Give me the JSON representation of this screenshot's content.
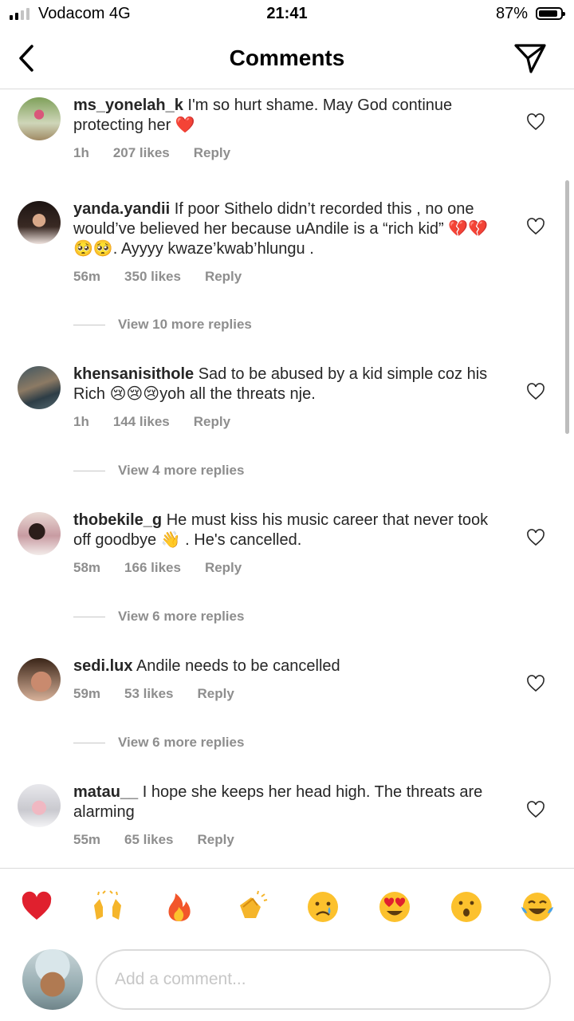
{
  "status_bar": {
    "carrier": "Vodacom  4G",
    "time": "21:41",
    "battery": "87%"
  },
  "header": {
    "title": "Comments"
  },
  "comments": [
    {
      "username": "ms_yonelah_k",
      "text": " I'm so hurt shame. May God continue protecting her ❤️",
      "age": "1h",
      "likes": "207 likes",
      "reply": "Reply"
    },
    {
      "username": "yanda.yandii",
      "text": " If poor Sithelo didn’t recorded this , no one would’ve believed her because uAndile is a “rich kid” 💔💔🥺🥺. Ayyyy kwaze’kwab’hlungu .",
      "age": "56m",
      "likes": "350 likes",
      "reply": "Reply",
      "view_replies": "View 10 more replies"
    },
    {
      "username": "khensanisithole",
      "text": " Sad to be abused by a kid simple coz his Rich 😢😢😢yoh all the threats nje.",
      "age": "1h",
      "likes": "144 likes",
      "reply": "Reply",
      "view_replies": "View 4 more replies"
    },
    {
      "username": "thobekile_g",
      "text": " He must kiss his music career that never took off  goodbye 👋 . He's cancelled.",
      "age": "58m",
      "likes": "166 likes",
      "reply": "Reply",
      "view_replies": "View 6 more replies"
    },
    {
      "username": "sedi.lux",
      "text": " Andile needs to be cancelled",
      "age": "59m",
      "likes": "53 likes",
      "reply": "Reply",
      "view_replies": "View 6 more replies"
    },
    {
      "username": "matau__",
      "text": " I hope she keeps her head high. The threats are alarming",
      "age": "55m",
      "likes": "65 likes",
      "reply": "Reply"
    }
  ],
  "reactions": [
    "❤️",
    "🙌",
    "🔥",
    "👏",
    "😢",
    "😍",
    "😮",
    "😂"
  ],
  "composer": {
    "placeholder": "Add a comment..."
  },
  "colors": {
    "secondary_text": "#8e8e8e",
    "divider": "#dbdbdb",
    "heart": "#ed4956"
  }
}
